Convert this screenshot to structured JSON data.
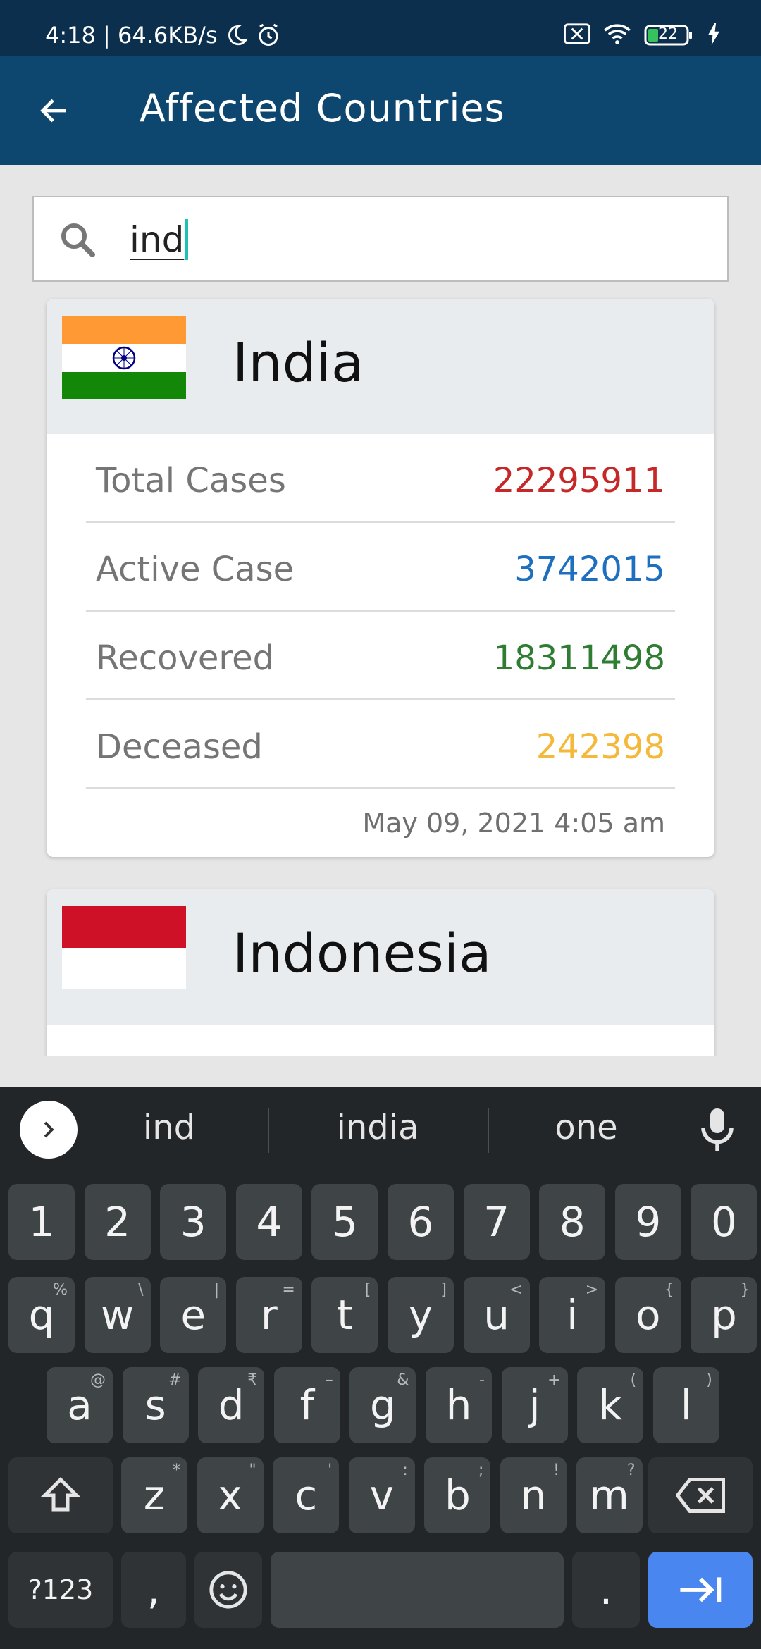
{
  "status_bar": {
    "time_speed": "4:18 | 64.6KB/s",
    "icons": [
      "moon-icon",
      "alarm-icon",
      "sim-off-icon",
      "wifi-icon",
      "battery-icon",
      "charging-icon"
    ],
    "battery": "22"
  },
  "app_bar": {
    "title": "Affected Countries",
    "back_icon": "arrow-left-icon"
  },
  "search": {
    "value": "ind",
    "icon": "search-icon"
  },
  "countries": [
    {
      "name": "India",
      "flag": "india-flag",
      "stats": [
        {
          "label": "Total Cases",
          "value": "22295911",
          "color": "#c62828"
        },
        {
          "label": "Active Case",
          "value": "3742015",
          "color": "#1e6fc0"
        },
        {
          "label": "Recovered",
          "value": "18311498",
          "color": "#2e7d32"
        },
        {
          "label": "Deceased",
          "value": "242398",
          "color": "#f4b93a"
        }
      ],
      "updated": "May 09, 2021 4:05 am"
    },
    {
      "name": "Indonesia",
      "flag": "indonesia-flag"
    }
  ],
  "keyboard": {
    "suggestions": [
      "ind",
      "india",
      "one"
    ],
    "row_numbers": [
      "1",
      "2",
      "3",
      "4",
      "5",
      "6",
      "7",
      "8",
      "9",
      "0"
    ],
    "row1": [
      {
        "k": "q",
        "s": "%"
      },
      {
        "k": "w",
        "s": "\\"
      },
      {
        "k": "e",
        "s": "|"
      },
      {
        "k": "r",
        "s": "="
      },
      {
        "k": "t",
        "s": "["
      },
      {
        "k": "y",
        "s": "]"
      },
      {
        "k": "u",
        "s": "<"
      },
      {
        "k": "i",
        "s": ">"
      },
      {
        "k": "o",
        "s": "{"
      },
      {
        "k": "p",
        "s": "}"
      }
    ],
    "row2": [
      {
        "k": "a",
        "s": "@"
      },
      {
        "k": "s",
        "s": "#"
      },
      {
        "k": "d",
        "s": "₹"
      },
      {
        "k": "f",
        "s": "–"
      },
      {
        "k": "g",
        "s": "&"
      },
      {
        "k": "h",
        "s": "-"
      },
      {
        "k": "j",
        "s": "+"
      },
      {
        "k": "k",
        "s": "("
      },
      {
        "k": "l",
        "s": ")"
      }
    ],
    "row3": [
      {
        "k": "z",
        "s": "*"
      },
      {
        "k": "x",
        "s": "\""
      },
      {
        "k": "c",
        "s": "'"
      },
      {
        "k": "v",
        "s": ":"
      },
      {
        "k": "b",
        "s": ";"
      },
      {
        "k": "n",
        "s": "!"
      },
      {
        "k": "m",
        "s": "?"
      }
    ],
    "symbols_key": "?123",
    "comma_key": ",",
    "period_key": "."
  }
}
